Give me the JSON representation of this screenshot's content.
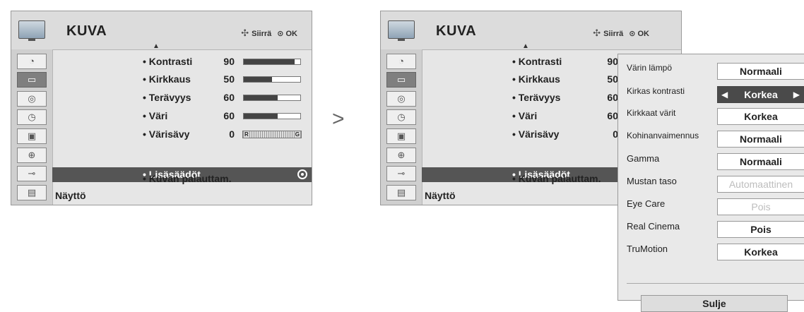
{
  "menu": {
    "title": "KUVA",
    "nav_move": "Siirrä",
    "nav_ok": "OK",
    "footer": "Näyttö",
    "items": [
      {
        "label": "• Kontrasti",
        "value": "90",
        "level": 0.9
      },
      {
        "label": "• Kirkkaus",
        "value": "50",
        "level": 0.5
      },
      {
        "label": "• Terävyys",
        "value": "60",
        "level": 0.6
      },
      {
        "label": "• Väri",
        "value": "60",
        "level": 0.6
      },
      {
        "label": "• Värisävy",
        "value": "0",
        "tint_r": "R",
        "tint_g": "G"
      },
      {
        "label": "• Lisäsäädöt"
      },
      {
        "label": "• Kuvan palauttam."
      }
    ]
  },
  "submenu": {
    "rows": [
      {
        "label": "Värin lämpö",
        "value": "Normaali"
      },
      {
        "label": "Kirkas kontrasti",
        "value": "Korkea",
        "left_arrow": "◀",
        "right_arrow": "▶"
      },
      {
        "label": "Kirkkaat värit",
        "value": "Korkea"
      },
      {
        "label": "Kohinanvaimennus",
        "value": "Normaali"
      },
      {
        "label": "Gamma",
        "value": "Normaali"
      },
      {
        "label": "Mustan taso",
        "value": "Automaattinen"
      },
      {
        "label": "Eye Care",
        "value": "Pois"
      },
      {
        "label": "Real Cinema",
        "value": "Pois"
      },
      {
        "label": "TruMotion",
        "value": "Korkea"
      }
    ],
    "close_label": "Sulje"
  },
  "transition_arrow": ">"
}
